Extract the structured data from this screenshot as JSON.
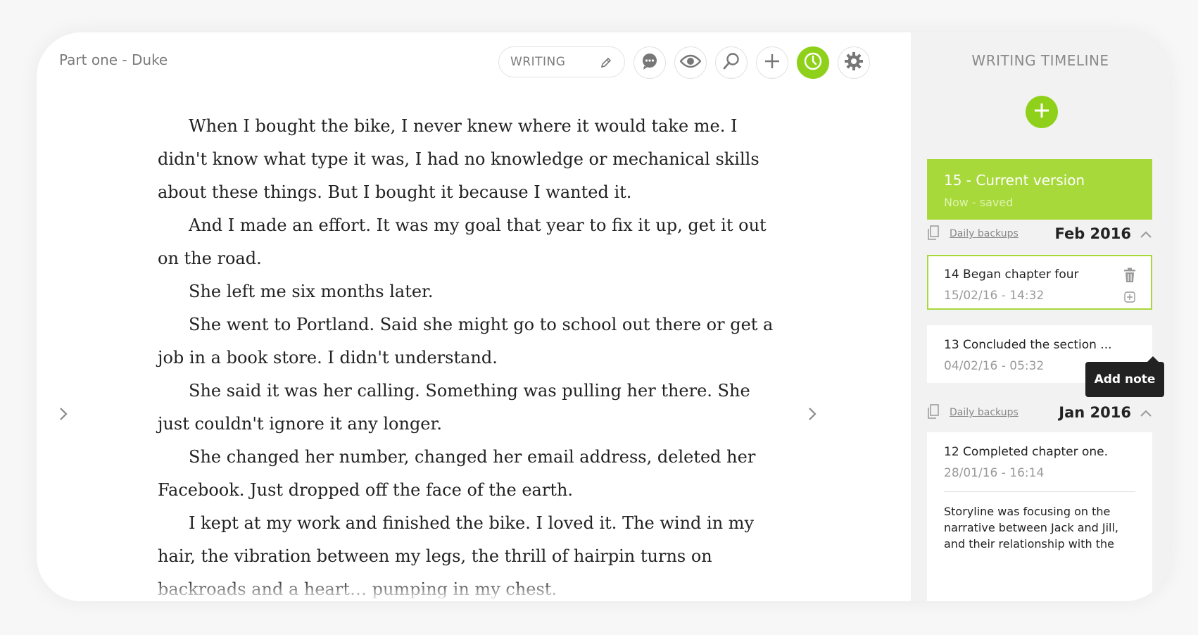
{
  "document": {
    "title": "Part one - Duke"
  },
  "toolbar": {
    "mode_label": "WRITING",
    "buttons": [
      "comments-icon",
      "preview-eye-icon",
      "search-icon",
      "add-icon",
      "timeline-clock-icon",
      "settings-gear-icon"
    ]
  },
  "colors": {
    "accent": "#8fd11a",
    "current_version_bg": "#a7d93a"
  },
  "editor": {
    "paragraphs": [
      "When I bought the bike, I never knew where it would take me. I didn't know what type it was, I had no knowledge or mechanical skills about these things. But I bought it because I wanted it.",
      "And I made an effort. It was my goal that year to fix it up, get it out on the road.",
      "She left me six months later.",
      "She went to Portland. Said she might go to school out there or get a job in a book store. I didn't understand.",
      "She said it was her calling. Something was pulling her there. She just couldn't ignore it any longer.",
      "She changed her number, changed her email address, deleted her Facebook. Just dropped off the face of the earth.",
      "I kept at my work and finished the bike. I loved it. The wind in my hair, the vibration between my legs, the thrill of hairpin turns on backroads and a heart… pumping in my chest."
    ]
  },
  "sidebar": {
    "title": "WRITING TIMELINE",
    "current": {
      "title": "15 - Current version",
      "subtitle": "Now - saved"
    },
    "groups": [
      {
        "daily_label": "Daily backups",
        "month": "Feb  2016",
        "versions": [
          {
            "title": "14   Began chapter four",
            "date": "15/02/16 - 14:32"
          },
          {
            "title": "13   Concluded the section ...",
            "date": "04/02/16 - 05:32"
          }
        ]
      },
      {
        "daily_label": "Daily backups",
        "month": "Jan 2016",
        "versions": [
          {
            "title": "12   Completed chapter one.",
            "date": "28/01/16 - 16:14",
            "note": "Storyline was focusing on the narrative between Jack and Jill, and their relationship with the"
          }
        ]
      }
    ],
    "tooltip": "Add note"
  }
}
